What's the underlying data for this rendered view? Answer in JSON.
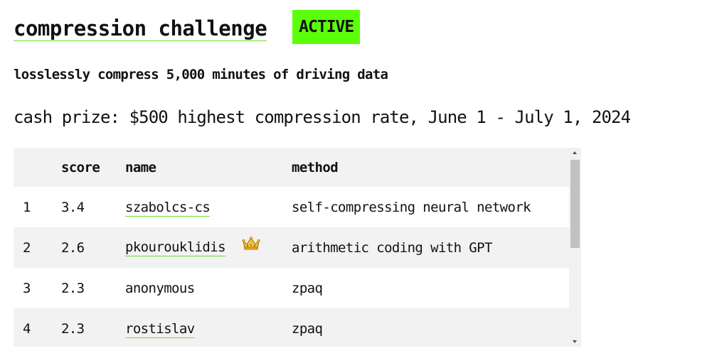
{
  "header": {
    "title": "compression challenge",
    "status": "ACTIVE",
    "status_color": "#5cff0a",
    "accent_underline": "#66e22a"
  },
  "subtitle": "losslessly compress 5,000 minutes of driving data",
  "prize": "cash prize: $500 highest compression rate, June 1 - July 1, 2024",
  "leaderboard": {
    "columns": [
      "",
      "score",
      "name",
      "method"
    ],
    "rows": [
      {
        "rank": "1",
        "score": "3.4",
        "name": "szabolcs-cs",
        "linked": true,
        "badge": "",
        "method": "self-compressing neural network"
      },
      {
        "rank": "2",
        "score": "2.6",
        "name": "pkourouklidis",
        "linked": true,
        "badge": "crown-icon",
        "method": "arithmetic coding with GPT"
      },
      {
        "rank": "3",
        "score": "2.3",
        "name": "anonymous",
        "linked": false,
        "badge": "",
        "method": "zpaq"
      },
      {
        "rank": "4",
        "score": "2.3",
        "name": "rostislav",
        "linked": true,
        "badge": "",
        "method": "zpaq"
      }
    ]
  }
}
